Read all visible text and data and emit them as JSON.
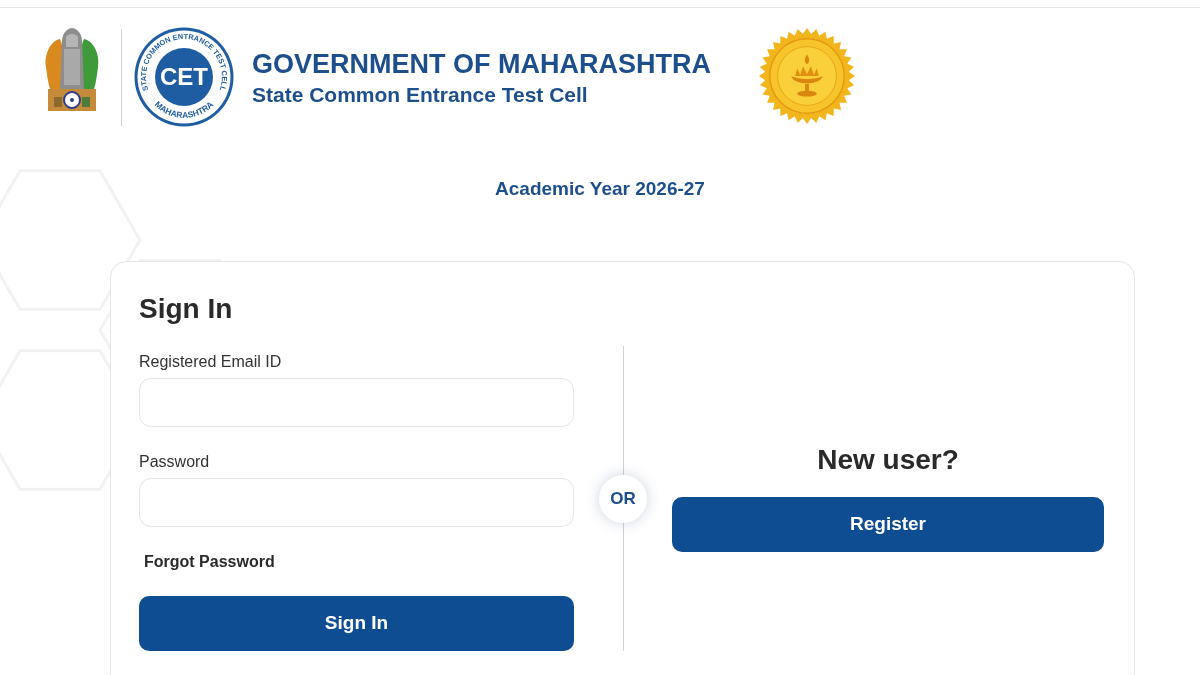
{
  "header": {
    "cet_logo": {
      "ring_text_top": "STATE COMMON ENTRANCE TEST CELL",
      "ring_text_bottom": "MAHARASHTRA",
      "center_text": "CET"
    },
    "title": "GOVERNMENT OF MAHARASHTRA",
    "subtitle": "State Common Entrance Test Cell"
  },
  "academic_year": "Academic Year 2026-27",
  "sign_in": {
    "heading": "Sign In",
    "fields": [
      {
        "label": "Registered Email ID"
      },
      {
        "label": "Password"
      }
    ],
    "forgot_link": "Forgot Password",
    "submit_button": "Sign In"
  },
  "separator": "OR",
  "register": {
    "heading": "New user?",
    "button": "Register"
  }
}
